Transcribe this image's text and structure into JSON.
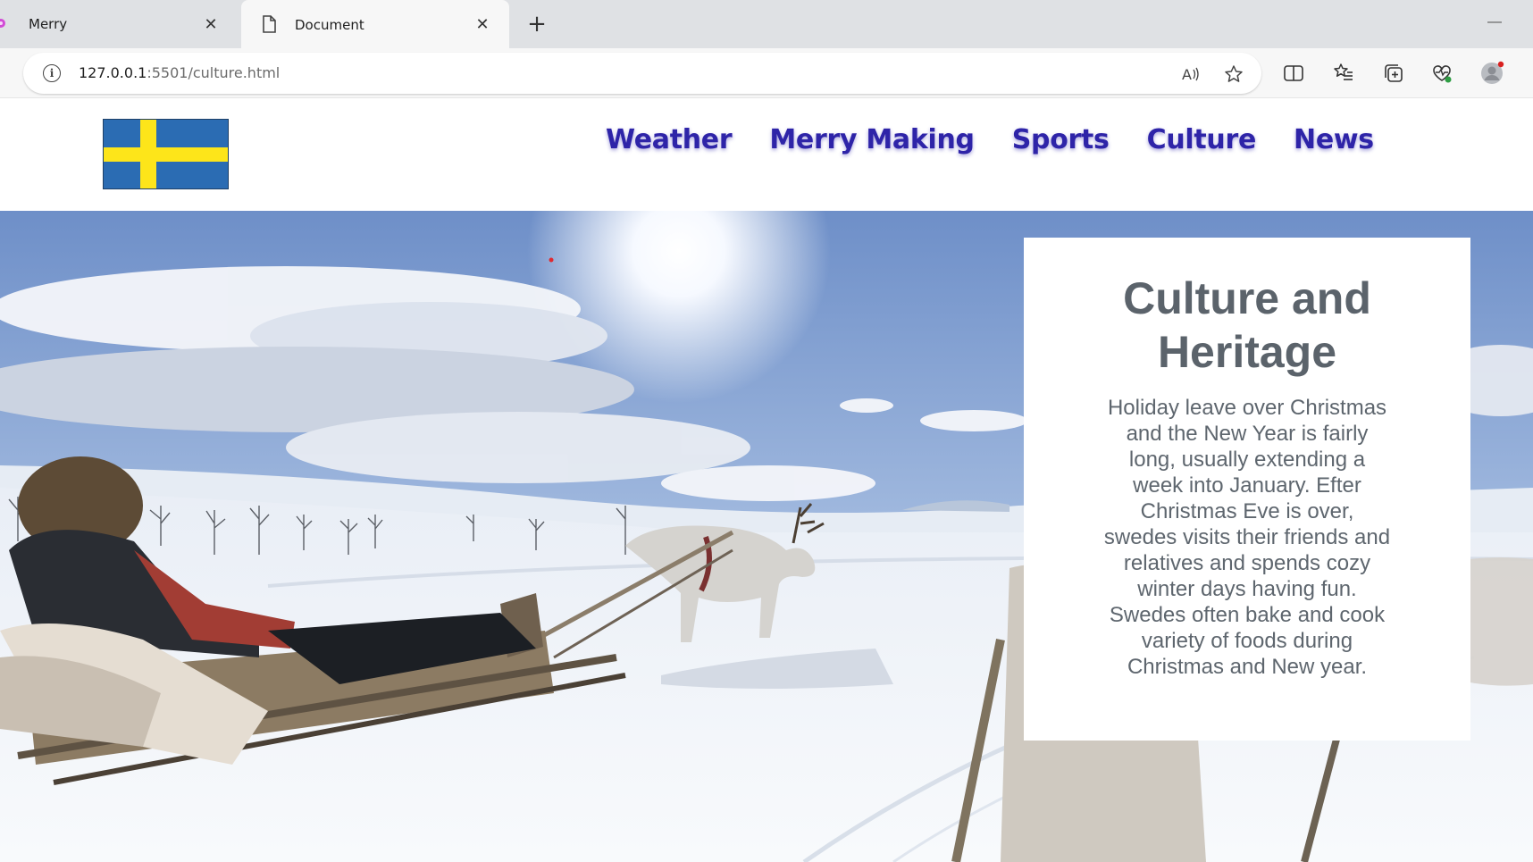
{
  "browser": {
    "tabs": [
      {
        "title": "Merry",
        "active": false
      },
      {
        "title": "Document",
        "active": true
      }
    ],
    "url": {
      "host": "127.0.0.1",
      "path": ":5501/culture.html"
    },
    "toolbar_icons": [
      "read-aloud-icon",
      "favorite-star-icon",
      "split-screen-icon",
      "favorites-icon",
      "collections-icon",
      "browser-essentials-icon",
      "profile-icon"
    ]
  },
  "site": {
    "logo": "sweden-flag",
    "nav": [
      "Weather",
      "Merry Making",
      "Sports",
      "Culture",
      "News"
    ],
    "colors": {
      "nav": "#2e24a8",
      "flag_blue": "#2b6cb3",
      "flag_yellow": "#fde51a",
      "card_text": "#5b636b"
    }
  },
  "hero": {
    "image": "reindeer-sled-snow-landscape",
    "card": {
      "title": "Culture and Heritage",
      "body": "Holiday leave over Christmas and the New Year is fairly long, usually extending a week into January. Efter Christmas Eve is over, swedes visits their friends and relatives and spends cozy winter days having fun. Swedes often bake and cook variety of foods during Christmas and New year."
    }
  }
}
